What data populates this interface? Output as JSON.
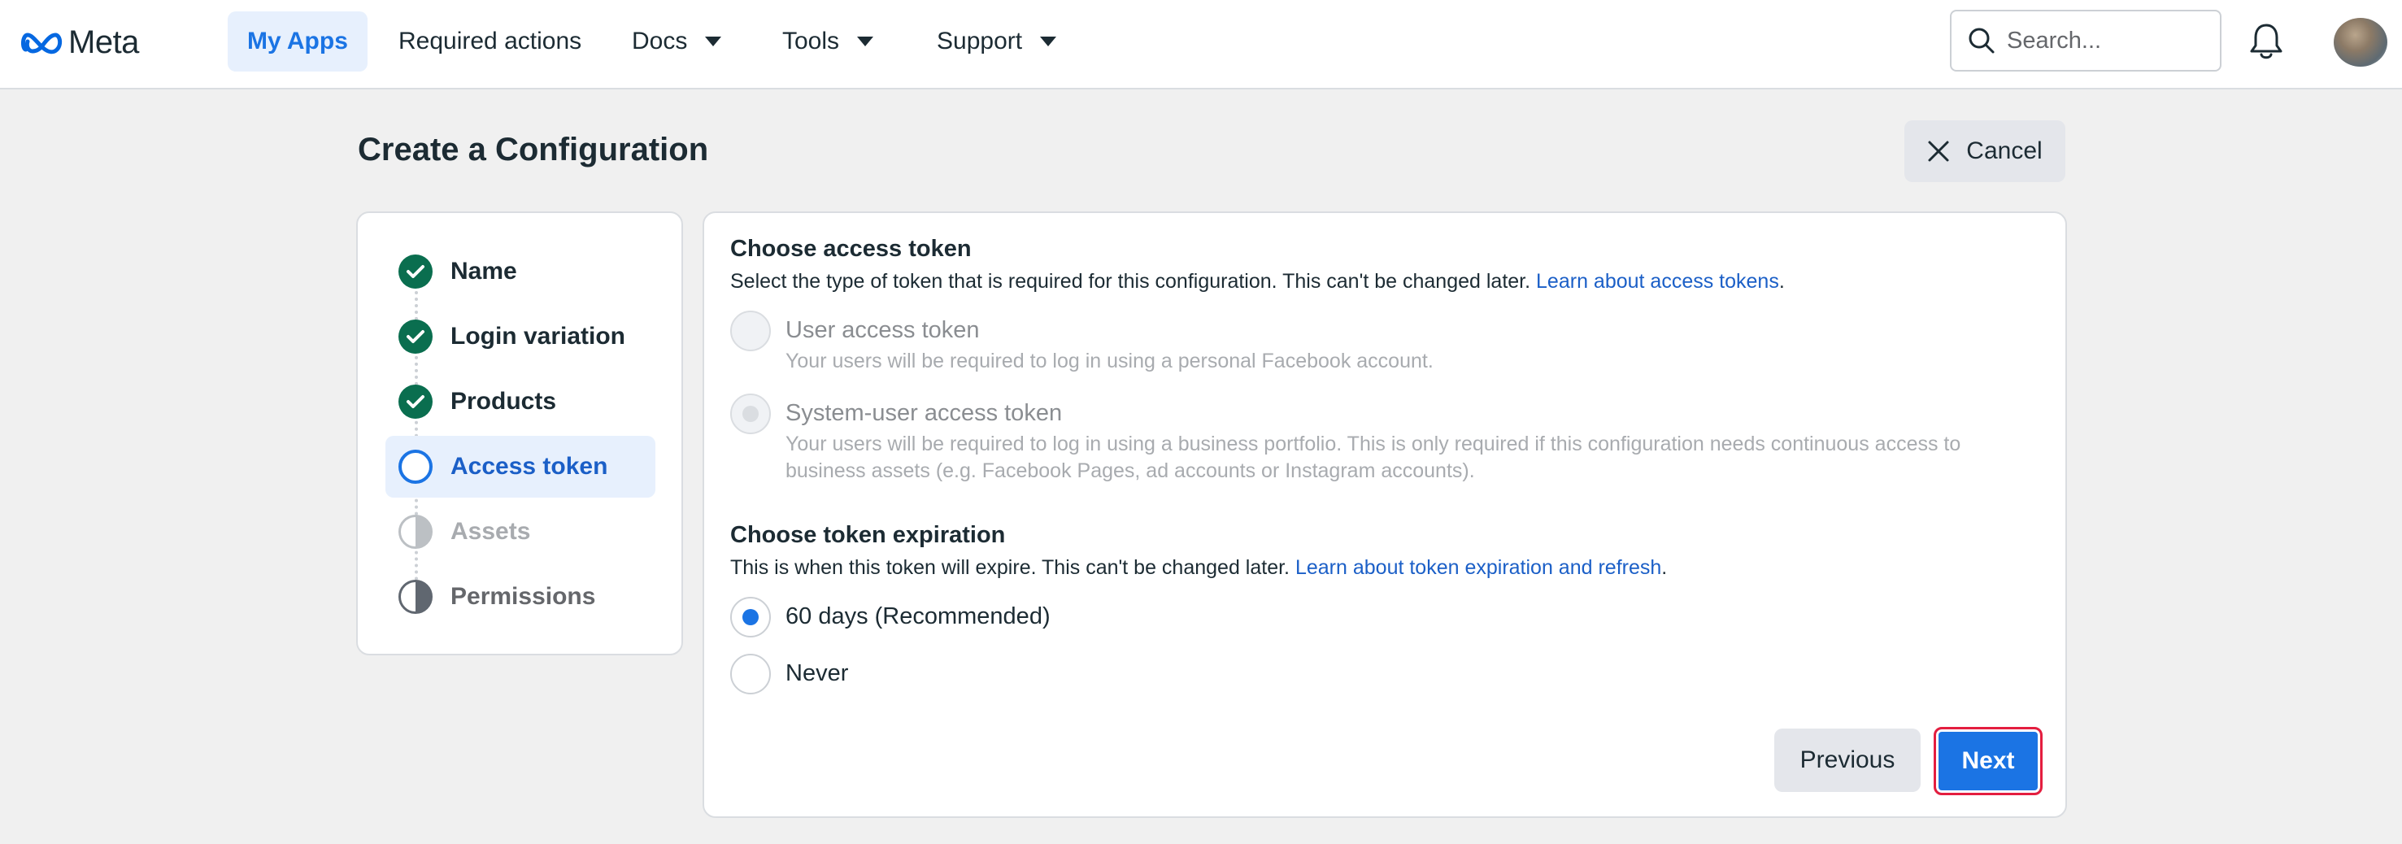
{
  "nav": {
    "brand": "Meta",
    "items": [
      {
        "label": "My Apps",
        "active": true
      },
      {
        "label": "Required actions"
      },
      {
        "label": "Docs",
        "dropdown": true
      },
      {
        "label": "Tools",
        "dropdown": true
      },
      {
        "label": "Support",
        "dropdown": true
      }
    ],
    "search_placeholder": "Search..."
  },
  "page": {
    "title": "Create a Configuration",
    "cancel_label": "Cancel"
  },
  "steps": [
    {
      "label": "Name",
      "status": "done"
    },
    {
      "label": "Login variation",
      "status": "done"
    },
    {
      "label": "Products",
      "status": "done"
    },
    {
      "label": "Access token",
      "status": "current"
    },
    {
      "label": "Assets",
      "status": "upcoming"
    },
    {
      "label": "Permissions",
      "status": "upcoming"
    }
  ],
  "access_token": {
    "title": "Choose access token",
    "description": "Select the type of token that is required for this configuration. This can't be changed later.",
    "link": "Learn about access tokens",
    "options": [
      {
        "label": "User access token",
        "sub": "Your users will be required to log in using a personal Facebook account.",
        "disabled": true,
        "checked": false
      },
      {
        "label": "System-user access token",
        "sub": "Your users will be required to log in using a business portfolio. This is only required if this configuration needs continuous access to business assets (e.g. Facebook Pages, ad accounts or Instagram accounts).",
        "disabled": true,
        "checked": true
      }
    ]
  },
  "expiration": {
    "title": "Choose token expiration",
    "description": "This is when this token will expire. This can't be changed later.",
    "link": "Learn about token expiration and refresh",
    "options": [
      {
        "label": "60 days (Recommended)",
        "checked": true
      },
      {
        "label": "Never",
        "checked": false
      }
    ]
  },
  "actions": {
    "previous_label": "Previous",
    "next_label": "Next"
  },
  "colors": {
    "accent": "#1b74e4",
    "done": "#0a6e4f",
    "highlight_border": "#e41e3f"
  }
}
